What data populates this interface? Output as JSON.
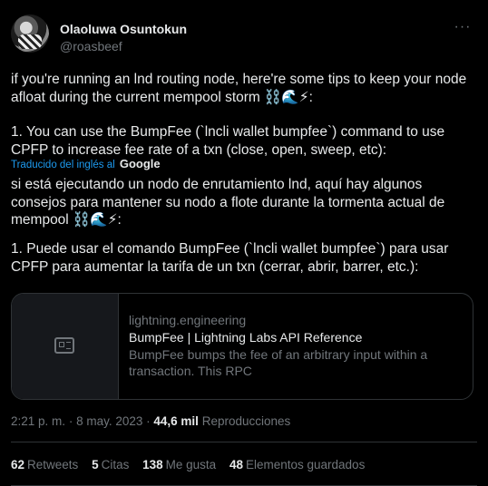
{
  "author": {
    "name": "Olaoluwa Osuntokun",
    "handle": "@roasbeef"
  },
  "tweet": {
    "text_original_p1": "if you're running an lnd routing node, here're some tips to keep your node afloat during the current mempool storm ⛓️🌊⚡:",
    "text_original_p2": "1. You can use the BumpFee (`lncli wallet bumpfee`) command to use CPFP to increase fee rate of a txn (close, open, sweep, etc):",
    "translated_label": "Traducido del inglés al",
    "translated_brand": "Google",
    "text_translated_p1": "si está ejecutando un nodo de enrutamiento lnd, aquí hay algunos consejos para mantener su nodo a flote durante la tormenta actual de mempool ⛓️🌊⚡:",
    "text_translated_p2": "1. Puede usar el comando BumpFee (`lncli wallet bumpfee`) para usar CPFP para aumentar la tarifa de un txn (cerrar, abrir, barrer, etc.):"
  },
  "card": {
    "domain": "lightning.engineering",
    "title": "BumpFee | Lightning Labs API Reference",
    "description": "BumpFee bumps the fee of an arbitrary input within a transaction. This RPC",
    "thumb_icon": "article-icon"
  },
  "meta": {
    "time": "2:21 p. m.",
    "separator": "·",
    "date": "8 may. 2023",
    "views_count": "44,6 mil",
    "views_label": "Reproducciones"
  },
  "stats": [
    {
      "count": "62",
      "label": "Retweets"
    },
    {
      "count": "5",
      "label": "Citas"
    },
    {
      "count": "138",
      "label": "Me gusta"
    },
    {
      "count": "48",
      "label": "Elementos guardados"
    }
  ],
  "more_icon": "more-icon",
  "colors": {
    "background": "#000000",
    "text": "#e7e9ea",
    "muted": "#71767b",
    "link": "#1d9bf0",
    "border": "#2f3336"
  }
}
